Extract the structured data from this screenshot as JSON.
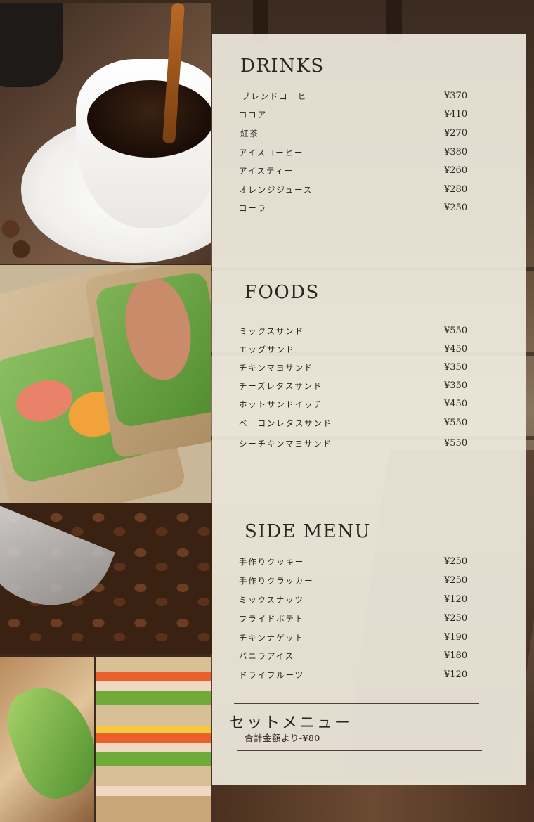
{
  "drinks": {
    "title": "DRINKS",
    "items": [
      {
        "name": "ブレンドコーヒー",
        "price": "¥370"
      },
      {
        "name": "ココア",
        "price": "¥410"
      },
      {
        "name": "紅茶",
        "price": "¥270"
      },
      {
        "name": "アイスコーヒー",
        "price": "¥380"
      },
      {
        "name": "アイスティー",
        "price": "¥260"
      },
      {
        "name": "オレンジジュース",
        "price": "¥280"
      },
      {
        "name": "コーラ",
        "price": "¥250"
      }
    ]
  },
  "foods": {
    "title": "FOODS",
    "items": [
      {
        "name": "ミックスサンド",
        "price": "¥550"
      },
      {
        "name": "エッグサンド",
        "price": "¥450"
      },
      {
        "name": "チキンマヨサンド",
        "price": "¥350"
      },
      {
        "name": "チーズレタスサンド",
        "price": "¥350"
      },
      {
        "name": "ホットサンドイッチ",
        "price": "¥450"
      },
      {
        "name": "ベーコンレタスサンド",
        "price": "¥550"
      },
      {
        "name": "シーチキンマヨサンド",
        "price": "¥550"
      }
    ]
  },
  "side_menu": {
    "title": "SIDE MENU",
    "items": [
      {
        "name": "手作りクッキー",
        "price": "¥250"
      },
      {
        "name": "手作りクラッカー",
        "price": "¥250"
      },
      {
        "name": "ミックスナッツ",
        "price": "¥120"
      },
      {
        "name": "フライドポテト",
        "price": "¥250"
      },
      {
        "name": "チキンナゲット",
        "price": "¥190"
      },
      {
        "name": "バニラアイス",
        "price": "¥180"
      },
      {
        "name": "ドライフルーツ",
        "price": "¥120"
      }
    ]
  },
  "set_menu": {
    "title": "セットメニュー",
    "note": "合計金額より-¥80"
  },
  "colors": {
    "panel": "#f3f0e2",
    "text": "#2b241f"
  }
}
